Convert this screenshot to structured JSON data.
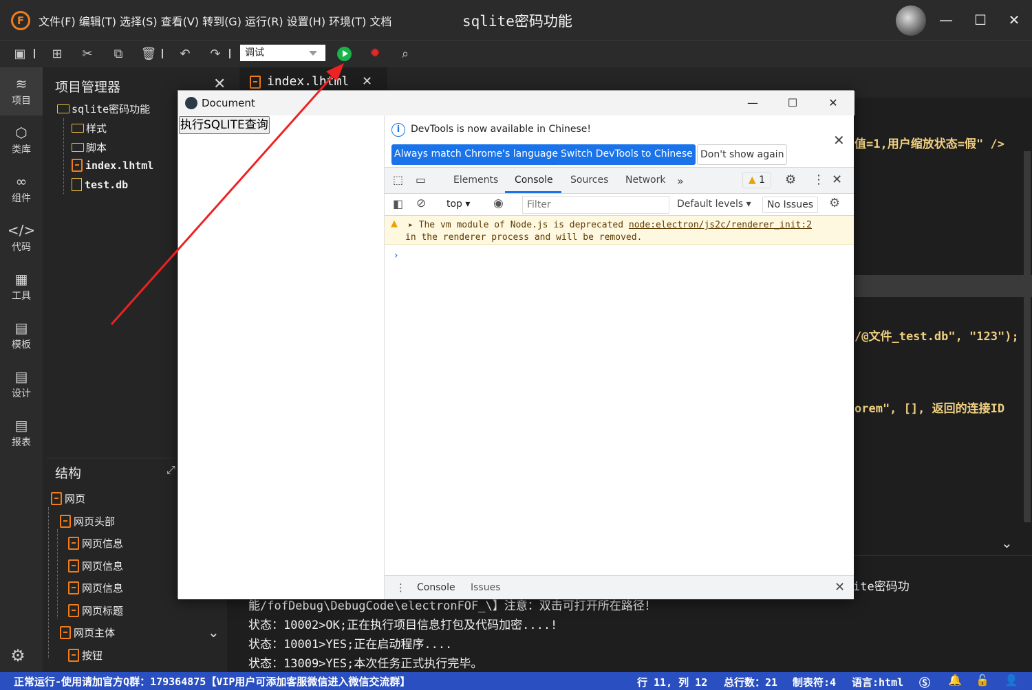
{
  "app": {
    "logo_letter": "F",
    "menus": [
      "文件(F)",
      "编辑(T)",
      "选择(S)",
      "查看(V)",
      "转到(G)",
      "运行(R)",
      "设置(H)",
      "环境(T)",
      "文档"
    ],
    "project_title": "sqlite密码功能"
  },
  "toolbar": {
    "mode_value": "调试"
  },
  "activity": [
    {
      "label": "项目",
      "icon": "layers-icon"
    },
    {
      "label": "类库",
      "icon": "cube-icon"
    },
    {
      "label": "组件",
      "icon": "link-icon"
    },
    {
      "label": "代码",
      "icon": "code-icon"
    },
    {
      "label": "工具",
      "icon": "grid-icon"
    },
    {
      "label": "模板",
      "icon": "template-icon"
    },
    {
      "label": "设计",
      "icon": "design-icon"
    },
    {
      "label": "报表",
      "icon": "report-icon"
    }
  ],
  "explorer": {
    "title": "项目管理器",
    "root": "sqlite密码功能",
    "items": [
      "样式",
      "脚本",
      "index.lhtml",
      "test.db"
    ]
  },
  "structure": {
    "title": "结构",
    "items": [
      "网页",
      "网页头部",
      "网页信息",
      "网页信息",
      "网页信息",
      "网页标题",
      "网页主体",
      "按钮"
    ]
  },
  "editor": {
    "tab": "index.lhtml",
    "code_lines": [
      "值=1,用户缩放状态=假\" />",
      "/@文件_test.db\", \"123\");",
      "orem\", [], 返回的连接ID",
      "ite密码功"
    ],
    "output_lines": [
      "能/fofDebug\\DebugCode\\electronFOF_\\】注意：双击可打开所在路径！",
      "状态：10002>OK;正在执行项目信息打包及代码加密....!",
      "状态：10001>YES;正在启动程序....",
      "状态：13009>YES;本次任务正式执行完毕。"
    ]
  },
  "status": {
    "left": "正常运行-使用请加官方Q群：179364875【VIP用户可添加客服微信进入微信交流群】",
    "position": "行 11, 列 12",
    "total_lines": "总行数：21",
    "tab_size": "制表符:4",
    "language": "语言:html"
  },
  "document": {
    "title": "Document",
    "button": "执行SQLITE查询"
  },
  "devtools": {
    "banner_text": "DevTools is now available in Chinese!",
    "btn_match": "Always match Chrome's language",
    "btn_switch": "Switch DevTools to Chinese",
    "btn_dont": "Don't show again",
    "tabs": [
      "Elements",
      "Console",
      "Sources",
      "Network"
    ],
    "active_tab": "Console",
    "warn_count": "1",
    "context": "top",
    "filter_placeholder": "Filter",
    "levels": "Default levels",
    "issues": "No Issues",
    "msg_line1": "The vm module of Node.js is deprecated",
    "msg_link": "node:electron/js2c/renderer_init:2",
    "msg_line2": "in the renderer process and will be removed.",
    "drawer_tabs": [
      "Console",
      "Issues"
    ]
  },
  "colors": {
    "accent_orange": "#f07d1c",
    "run_green": "#19b34a",
    "status_blue": "#2a4fc0",
    "devtools_blue": "#1a73e8",
    "arrow_red": "#ee2222"
  }
}
